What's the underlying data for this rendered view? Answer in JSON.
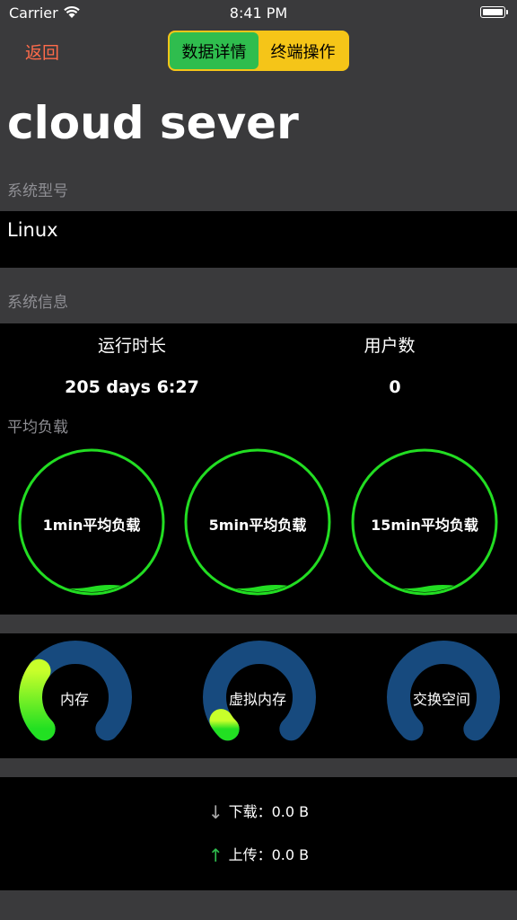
{
  "status_bar": {
    "carrier": "Carrier",
    "time": "8:41 PM"
  },
  "nav": {
    "back_label": "返回",
    "segments": [
      {
        "label": "数据详情",
        "active": true
      },
      {
        "label": "终端操作",
        "active": false
      }
    ]
  },
  "title": "cloud sever",
  "system_model": {
    "section_label": "系统型号",
    "value": "Linux"
  },
  "system_info": {
    "section_label": "系统信息",
    "uptime_label": "运行时长",
    "uptime_value": "205 days  6:27",
    "users_label": "用户数",
    "users_value": "0"
  },
  "load_average": {
    "section_label": "平均负载",
    "gauges": [
      {
        "label": "1min平均负载",
        "level": 0.05
      },
      {
        "label": "5min平均负载",
        "level": 0.05
      },
      {
        "label": "15min平均负载",
        "level": 0.05
      }
    ]
  },
  "memory": {
    "rings": [
      {
        "label": "内存",
        "level": 0.3
      },
      {
        "label": "虚拟内存",
        "level": 0.05
      },
      {
        "label": "交换空间",
        "level": 0.0
      }
    ]
  },
  "network": {
    "download_label": "下载：",
    "download_value": "0.0 B",
    "upload_label": "上传：",
    "upload_value": "0.0 B"
  },
  "colors": {
    "accent_green": "#2fbd4e",
    "segment_yellow": "#f5c518",
    "back_red": "#ff6b4a",
    "gauge_green": "#22dd22",
    "ring_blue": "#174a7e"
  }
}
